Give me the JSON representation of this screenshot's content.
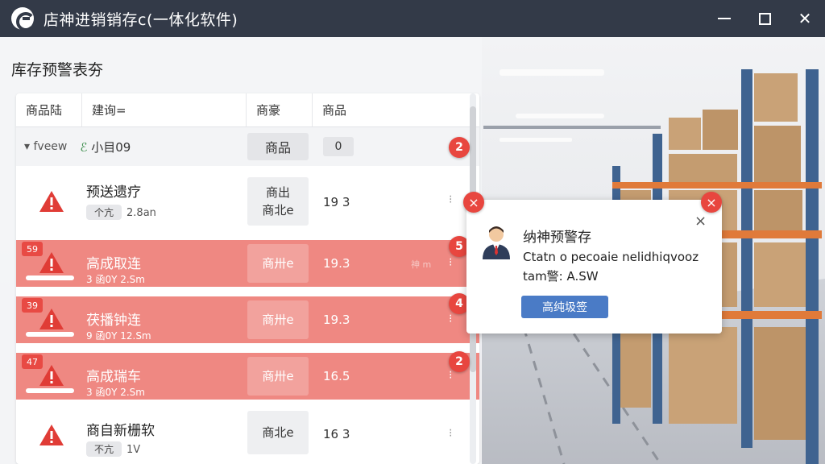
{
  "window": {
    "title": "店神进销销存c(一体化软件)",
    "minimize_icon": "minimize-icon",
    "maximize_icon": "maximize-icon",
    "close_icon": "close-icon"
  },
  "panel": {
    "title": "库存预警表夯"
  },
  "table": {
    "headers": [
      "商品陆",
      "建询=",
      "商豪",
      "商品"
    ],
    "group": {
      "toggle": "▾ fveew",
      "leaf": "ℰ",
      "name": "小目09",
      "col3": "商品",
      "col4": "0",
      "count": "2"
    },
    "rows": [
      {
        "title": "预送遗疗",
        "tag": "个亢",
        "sub": "2.8an",
        "col3_line1": "商出",
        "col3_line2": "商北e",
        "qty": "19 3",
        "style": "plain"
      },
      {
        "title": "高成取连",
        "badge": "59",
        "sub": "3 函0Y  2.Sm",
        "col3": "商卅e",
        "qty": "19.3",
        "hint": "神 m",
        "count": "5",
        "style": "alert"
      },
      {
        "title": "茯播钟连",
        "badge": "39",
        "sub": "9 函0Y  12.Sm",
        "col3": "商卅e",
        "qty": "19.3",
        "count": "4",
        "style": "alert"
      },
      {
        "title": "高成瑞车",
        "badge": "47",
        "sub": "3 函0Y  2.Sm",
        "col3": "商卅e",
        "qty": "16.5",
        "count": "2",
        "style": "alert"
      },
      {
        "title": "商自新栅软",
        "tag": "不亢",
        "sub": "1V",
        "col3": "商北e",
        "qty": "16 3",
        "style": "plain"
      }
    ]
  },
  "popup": {
    "title": "纳神预警存",
    "message": "Ctatn o pecoaie nelidhiqvooz",
    "message2": "tam警: A.SW",
    "button": "高纯圾签",
    "close": "×",
    "left_badge": "×",
    "right_badge": "×"
  },
  "colors": {
    "titlebar": "#333a48",
    "alert_row": "#ef8882",
    "badge_red": "#e8463f",
    "button_blue": "#4a7bc6"
  }
}
